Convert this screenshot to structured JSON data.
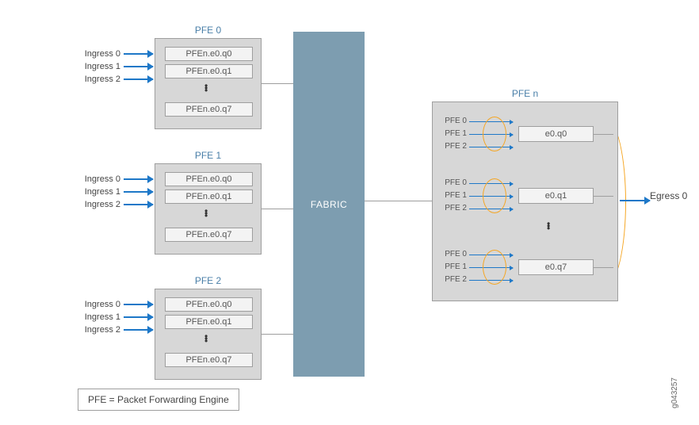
{
  "ingress_labels": [
    "Ingress 0",
    "Ingress 1",
    "Ingress 2"
  ],
  "pfe_boxes": [
    {
      "title": "PFE 0",
      "queues": [
        "PFEn.e0.q0",
        "PFEn.e0.q1",
        "PFEn.e0.q7"
      ]
    },
    {
      "title": "PFE 1",
      "queues": [
        "PFEn.e0.q0",
        "PFEn.e0.q1",
        "PFEn.e0.q7"
      ]
    },
    {
      "title": "PFE 2",
      "queues": [
        "PFEn.e0.q0",
        "PFEn.e0.q1",
        "PFEn.e0.q7"
      ]
    }
  ],
  "fabric_label": "FABRIC",
  "pfen": {
    "title": "PFE n",
    "src_labels": [
      "PFE 0",
      "PFE 1",
      "PFE 2"
    ],
    "eq_labels": [
      "e0.q0",
      "e0.q1",
      "e0.q7"
    ]
  },
  "egress_label": "Egress 0",
  "legend": "PFE = Packet Forwarding Engine",
  "image_id": "g043257"
}
